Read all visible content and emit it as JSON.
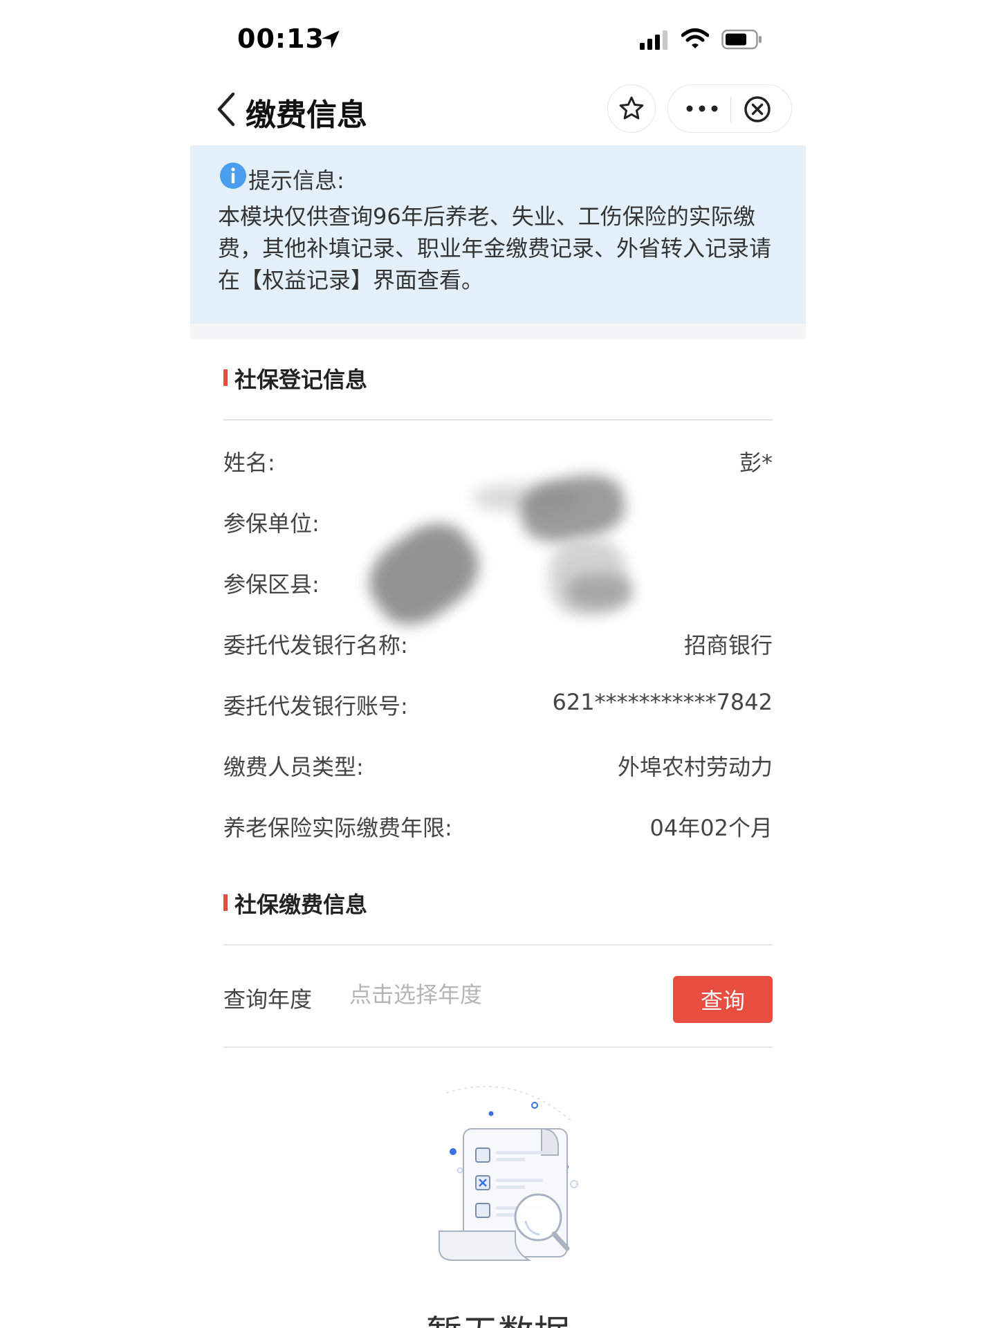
{
  "status_bar": {
    "time": "00:13",
    "icons": [
      "location-arrow-icon",
      "signal-icon",
      "wifi-icon",
      "battery-icon"
    ]
  },
  "nav": {
    "title": "缴费信息",
    "icons": [
      "back-icon",
      "star-icon",
      "more-icon",
      "close-icon"
    ]
  },
  "tip": {
    "title": "提示信息:",
    "text": "本模块仅供查询96年后养老、失业、工伤保险的实际缴费，其他补填记录、职业年金缴费记录、外省转入记录请在【权益记录】界面查看。",
    "background": "#e3f0fa",
    "icon": "info-icon",
    "icon_color": "#4a9eed"
  },
  "registration": {
    "title": "社保登记信息",
    "rows": [
      {
        "label": "姓名:",
        "value": "彭*"
      },
      {
        "label": "参保单位:",
        "value": ""
      },
      {
        "label": "参保区县:",
        "value": ""
      },
      {
        "label": "委托代发银行名称:",
        "value": "招商银行"
      },
      {
        "label": "委托代发银行账号:",
        "value": "621***********7842"
      },
      {
        "label": "缴费人员类型:",
        "value": "外埠农村劳动力"
      },
      {
        "label": "养老保险实际缴费年限:",
        "value": "04年02个月"
      }
    ]
  },
  "payment": {
    "title": "社保缴费信息",
    "query_label": "查询年度",
    "year_placeholder": "点击选择年度",
    "query_button": "查询",
    "accent_color": "#e84e40"
  },
  "empty": {
    "text": "暂无数据",
    "icon": "empty-document-search-icon"
  }
}
